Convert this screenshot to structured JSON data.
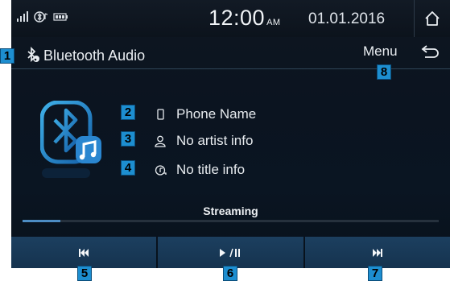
{
  "statusbar": {
    "time": "12:00",
    "ampm": "AM",
    "date": "01.01.2016",
    "home_icon": "home-icon"
  },
  "titlebar": {
    "title": "Bluetooth Audio",
    "menu_label": "Menu",
    "back_icon": "back-arrow-icon"
  },
  "track": {
    "phone_name": "Phone Name",
    "artist": "No artist info",
    "title": "No title info"
  },
  "playback": {
    "status": "Streaming",
    "progress": 0.09
  },
  "controls": {
    "prev_label": "⏮",
    "playpause_label": "▶/❚❚",
    "next_label": "⏭"
  },
  "callouts": [
    "1",
    "2",
    "3",
    "4",
    "5",
    "6",
    "7",
    "8"
  ],
  "colors": {
    "accent": "#1d8ed0",
    "button": "#1c3f5f",
    "background": "#0b1420"
  }
}
